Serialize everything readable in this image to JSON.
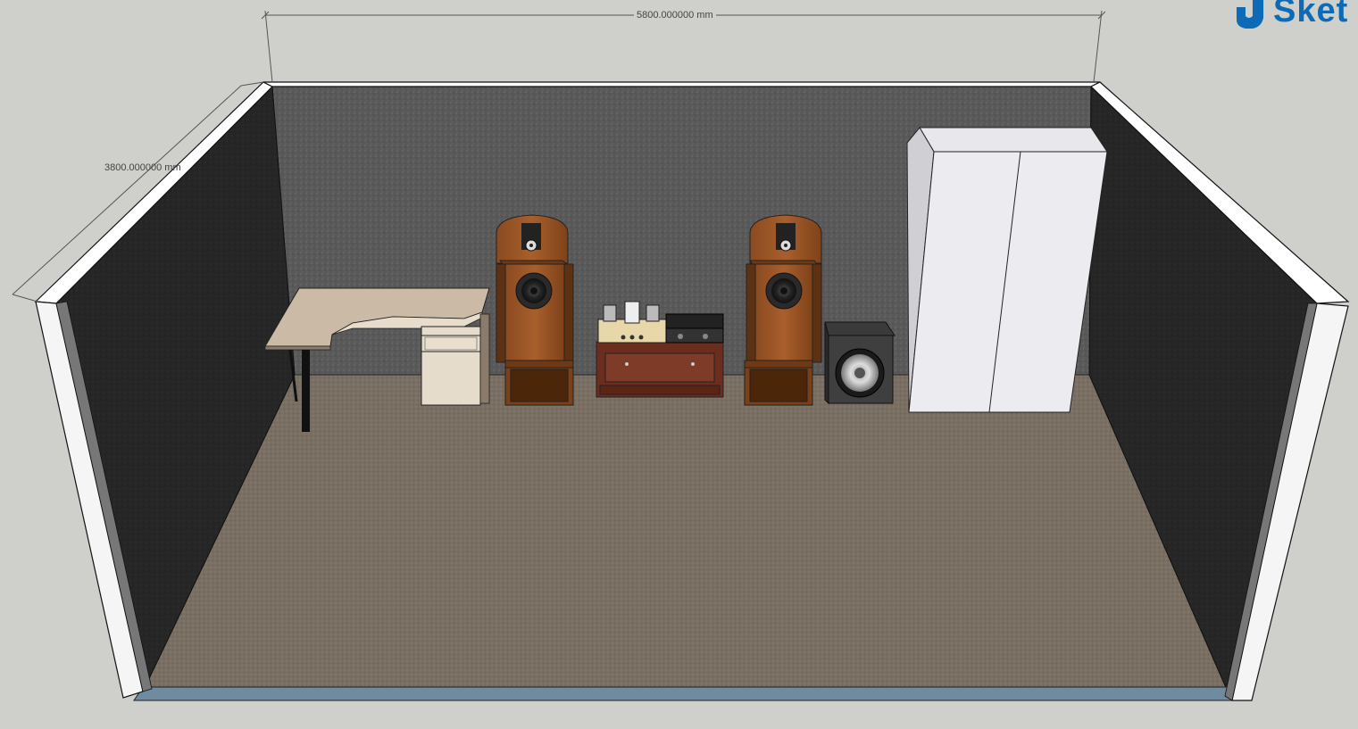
{
  "app": {
    "logo_text": "Sket",
    "logo_color": "#0d6ab7"
  },
  "dimensions": {
    "width_label": "5800.000000 mm",
    "depth_label": "3800.000000 mm"
  },
  "scene": {
    "wall_color": "#5a5a5a",
    "side_wall_color": "#2a2a2a",
    "floor_color": "#7b7064",
    "trim_color": "#ffffff",
    "background_color": "#cfd0cb"
  }
}
